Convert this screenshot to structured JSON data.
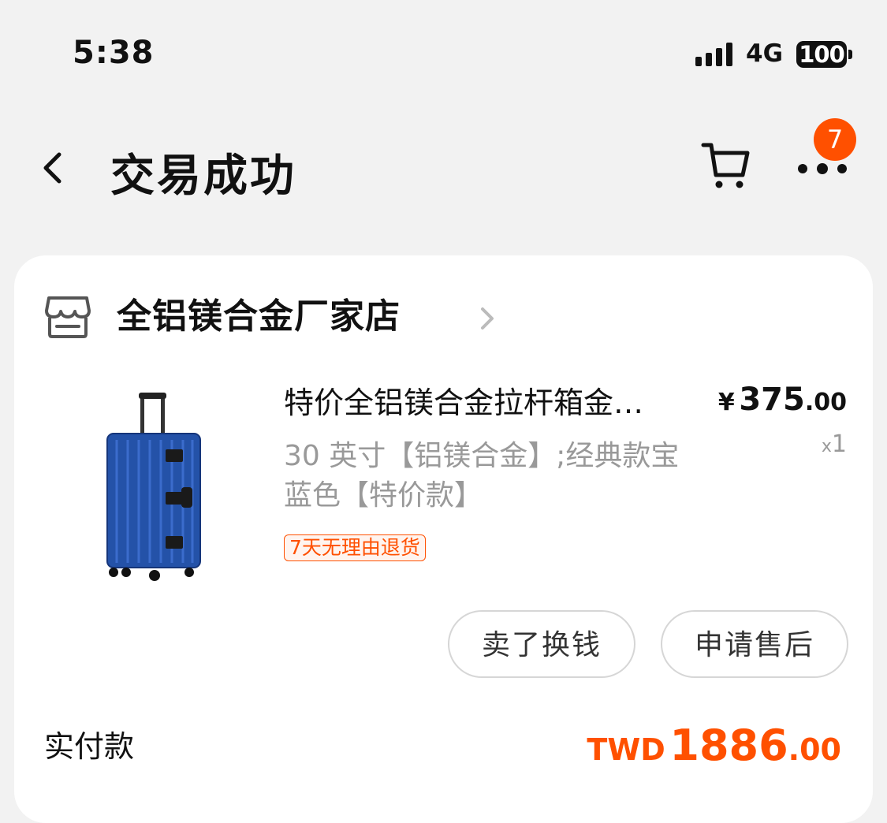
{
  "status_bar": {
    "time": "5:38",
    "network": "4G",
    "battery": "100"
  },
  "nav": {
    "title": "交易成功",
    "more_badge_count": "7"
  },
  "store": {
    "name": "全铝镁合金厂家店"
  },
  "product": {
    "title": "特价全铝镁合金拉杆箱金…",
    "sku": "30 英寸【铝镁合金】;经典款宝蓝色【特价款】",
    "tag": "7天无理由退货",
    "price_currency": "¥",
    "price_integer": "375",
    "price_decimal": ".00",
    "quantity_prefix": "x",
    "quantity": "1"
  },
  "actions": {
    "sell_label": "卖了换钱",
    "after_sale_label": "申请售后"
  },
  "payment": {
    "label": "实付款",
    "currency": "TWD",
    "integer": "1886",
    "decimal": ".00"
  },
  "colors": {
    "accent": "#ff5000",
    "background": "#f2f2f2",
    "card": "#ffffff",
    "suitcase": "#2452a8"
  },
  "icons": [
    "back-arrow-icon",
    "cart-icon",
    "more-icon",
    "store-icon",
    "chevron-right-icon"
  ]
}
